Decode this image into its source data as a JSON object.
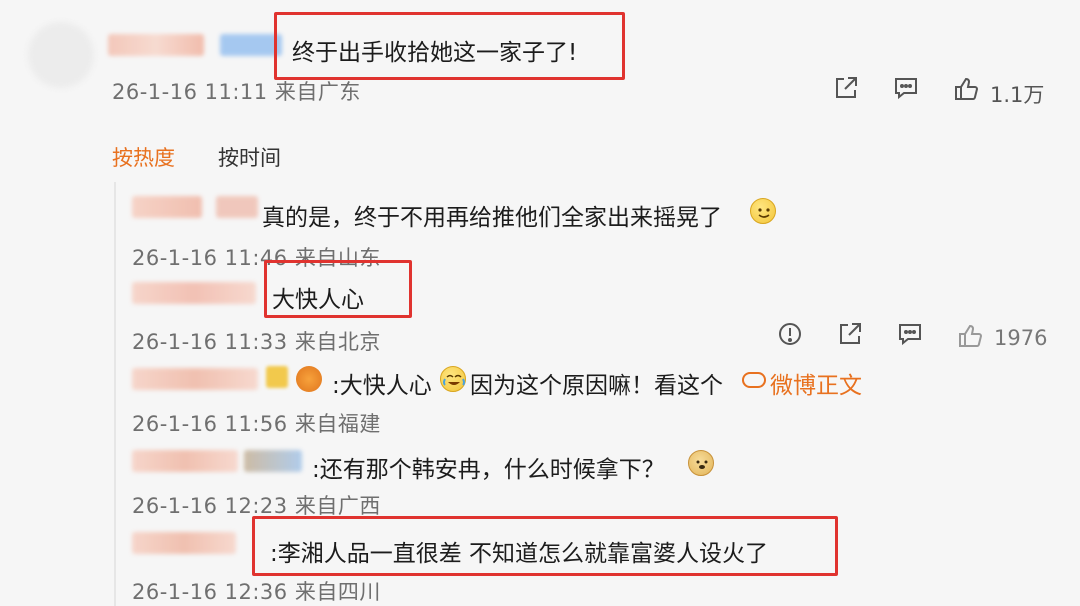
{
  "main_comment": {
    "text": "终于出手收拾她这一家子了!",
    "time": "26-1-16 11:11 来自广东",
    "like_count": "1.1万",
    "actions": [
      "share-icon",
      "comment-icon",
      "like-icon"
    ]
  },
  "sort_tabs": [
    {
      "label": "按热度",
      "active": true
    },
    {
      "label": "按时间",
      "active": false
    }
  ],
  "replies": [
    {
      "text": "真的是，终于不用再给推他们全家出来摇晃了",
      "time": "26-1-16 11:46 来自山东",
      "emoji": "smile-emoji-icon"
    },
    {
      "text": "大快人心",
      "time": "26-1-16 11:33 来自北京",
      "like_count": "1976",
      "actions": [
        "report-icon",
        "share-icon",
        "comment-icon",
        "like-icon"
      ]
    },
    {
      "text_prefix": ":大快人心",
      "text_mid": "因为这个原因嘛！看这个",
      "link_text": "微博正文",
      "time": "26-1-16 11:56 来自福建",
      "emoji": "cry-laugh-emoji-icon"
    },
    {
      "text": ":还有那个韩安冉，什么时候拿下？",
      "time": "26-1-16 12:23 来自广西",
      "emoji": "doge-emoji-icon"
    },
    {
      "text": ":李湘人品一直很差 不知道怎么就靠富婆人设火了",
      "time": "26-1-16 12:36 来自四川"
    }
  ],
  "colors": {
    "highlight_box": "#e0332f",
    "active_tab": "#e8711f",
    "link": "#e8711f",
    "timestamp": "#6f6f6f"
  }
}
